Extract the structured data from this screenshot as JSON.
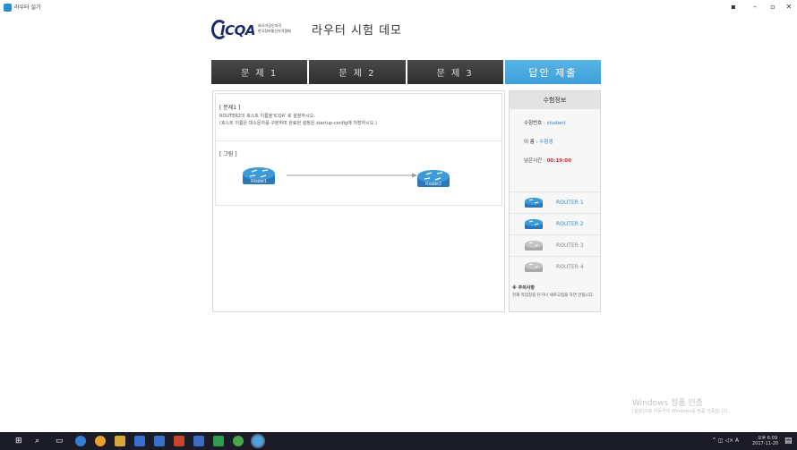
{
  "window": {
    "title": "라우터 실기",
    "minimize_glyph": "–",
    "maximize_glyph": "▫",
    "close_glyph": "✕",
    "extra_glyph": "▪"
  },
  "header": {
    "logo_text": "ICQA",
    "logo_line1": "㈔국가공인자격",
    "logo_line2": "한국정보통신자격협회",
    "title": "라우터 시험 데모",
    "brand_color": "#1a2b6b"
  },
  "tabs": [
    {
      "label": "문 제 1"
    },
    {
      "label": "문 제 2"
    },
    {
      "label": "문 제 3"
    },
    {
      "label": "답안 제출"
    }
  ],
  "question": {
    "label": "[ 문제1 ]",
    "line1": "ROUTER2의 호스트 이름을'ICQA' 로 설정하시오.",
    "line2": "(호스트 이름은 대소문자를 구분하며 완료된 설정은 startup-config에 저장하시오.)",
    "figure_label": "[ 그림 ]",
    "router1_name": "Router1",
    "router2_name": "Router2"
  },
  "side": {
    "title": "수험정보",
    "exam_no_label": "수험번호 : ",
    "exam_no_value": "student",
    "name_label": "이 름 : ",
    "name_value": "수험생",
    "time_label": "남은시간 : ",
    "time_value": "00:19:00",
    "routers": [
      {
        "label": "ROUTER 1",
        "active": true
      },
      {
        "label": "ROUTER 2",
        "active": true
      },
      {
        "label": "ROUTER 3",
        "active": false
      },
      {
        "label": "ROUTER 4",
        "active": false
      }
    ],
    "notice_title": "※ 주의사항",
    "notice_text": "현재 작업창을 닫거나 새로고침을 하면 안됩니다."
  },
  "watermark": {
    "line1": "Windows 정품 인증",
    "line2": "[설정]으로 이동하여 Windows를 정품 인증합니다."
  },
  "taskbar": {
    "tray": "^ ◫ ◁× A",
    "clock_time": "오후 6:09",
    "clock_date": "2017-11-20"
  },
  "colors": {
    "accent": "#3e9fd8",
    "router_active": "#2f86c2",
    "router_inactive": "#b8b8b8",
    "timer": "#e8202a"
  }
}
